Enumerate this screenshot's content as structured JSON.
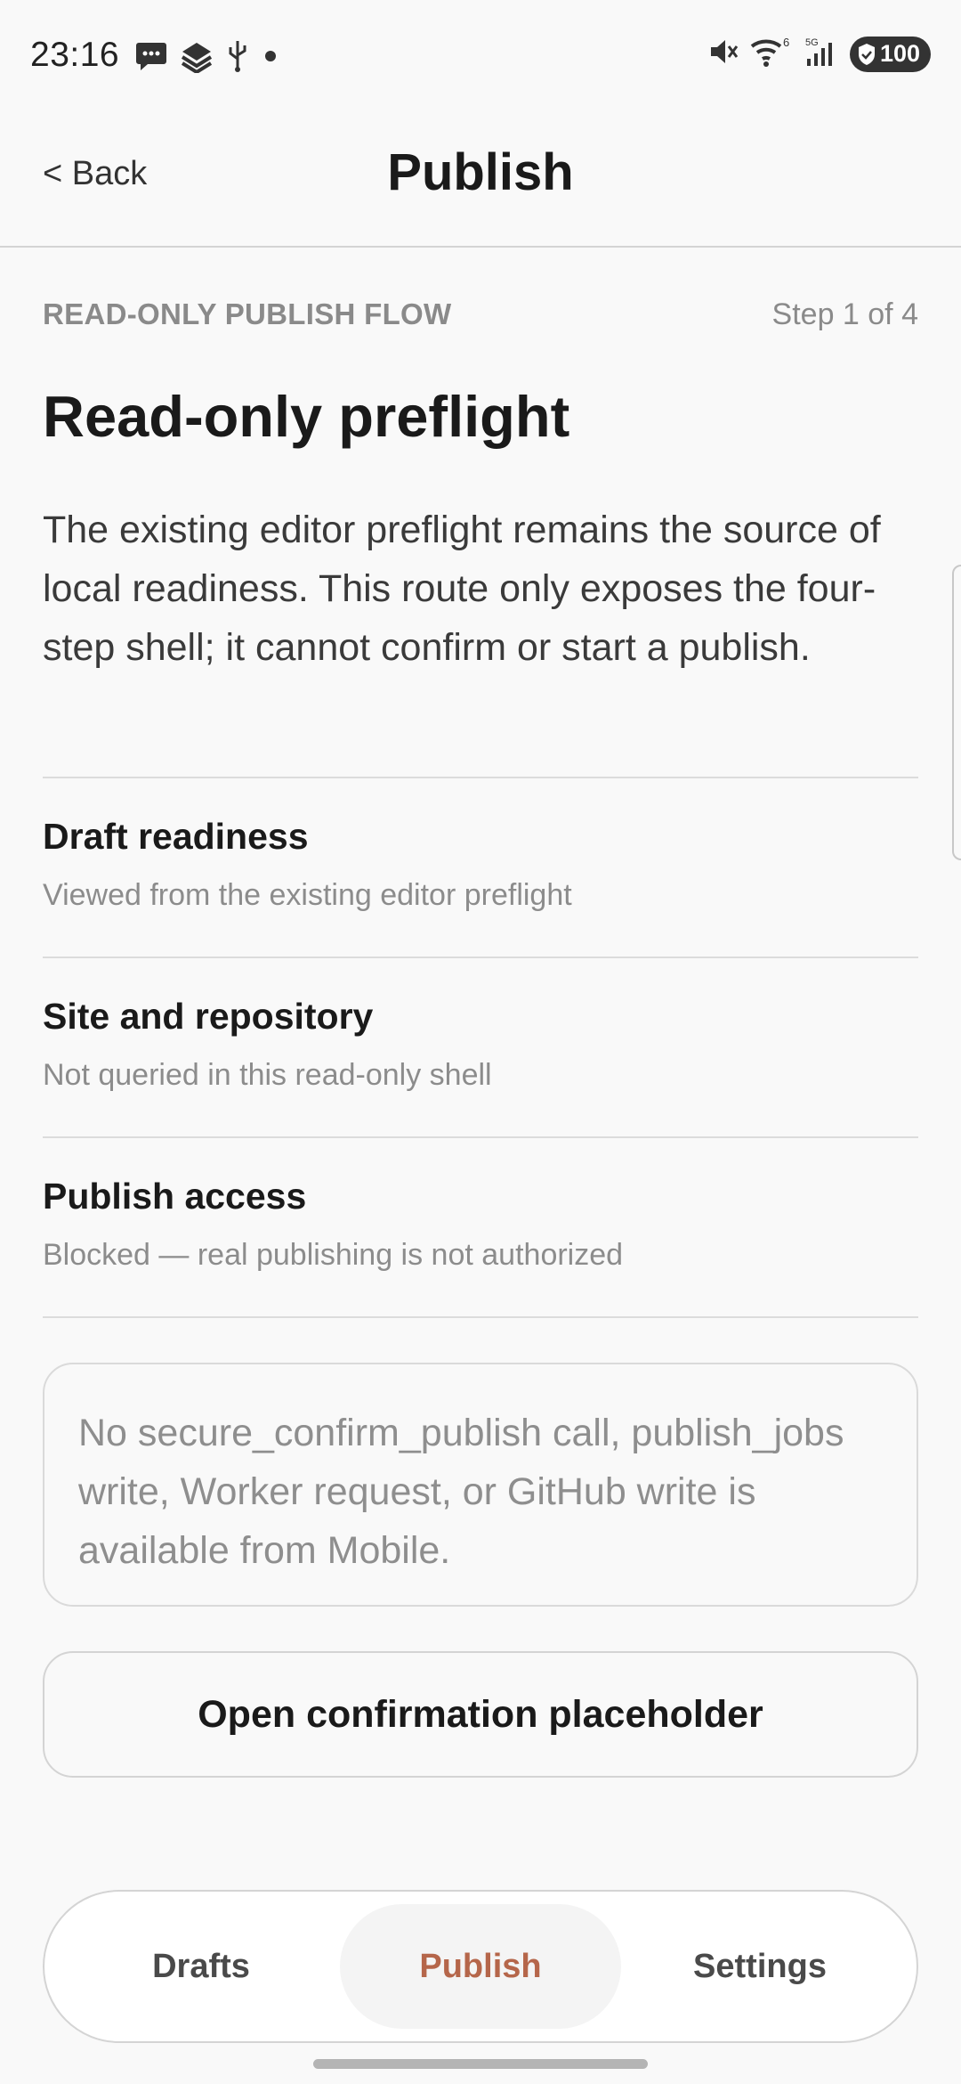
{
  "status_bar": {
    "time": "23:16",
    "left_icons": [
      "chat-icon",
      "stack-icon",
      "usb-icon",
      "dot-icon"
    ],
    "right_icons": [
      "mute-icon",
      "wifi-icon",
      "signal-icon"
    ],
    "wifi_label": "6",
    "signal_label": "5G",
    "battery": "100"
  },
  "header": {
    "back_label": "< Back",
    "title": "Publish"
  },
  "flow": {
    "eyebrow": "READ-ONLY PUBLISH FLOW",
    "step": "Step 1 of 4",
    "title": "Read-only preflight",
    "description": "The existing editor preflight remains the source of local readiness. This route only exposes the four-step shell; it cannot confirm or start a publish."
  },
  "checklist": [
    {
      "title": "Draft readiness",
      "subtitle": "Viewed from the existing editor preflight"
    },
    {
      "title": "Site and repository",
      "subtitle": "Not queried in this read-only shell"
    },
    {
      "title": "Publish access",
      "subtitle": "Blocked — real publishing is not authorized"
    }
  ],
  "notice": "No secure_confirm_publish call, publish_jobs write, Worker request, or GitHub write is available from Mobile.",
  "placeholder_button": "Open confirmation placeholder",
  "nav": {
    "tabs": [
      {
        "label": "Drafts"
      },
      {
        "label": "Publish"
      },
      {
        "label": "Settings"
      }
    ],
    "active_tab": "Publish"
  },
  "colors": {
    "accent": "#b5664a",
    "background": "#f9f9f9",
    "muted": "#8a8a8a"
  }
}
